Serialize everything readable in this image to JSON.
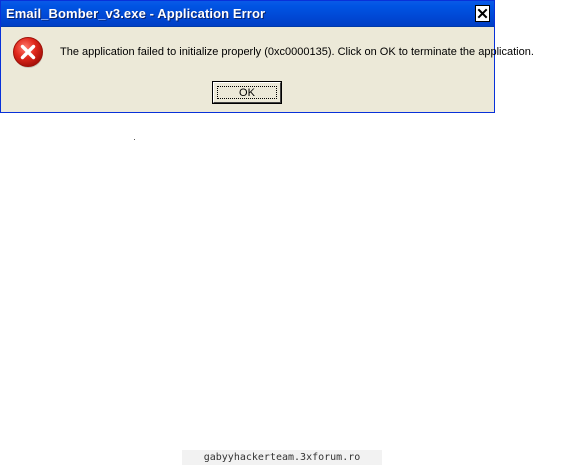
{
  "window": {
    "title": "Email_Bomber_v3.exe - Application Error",
    "close_icon": "close-icon"
  },
  "dialog": {
    "icon": "error-icon",
    "message": "The application failed to initialize properly (0xc0000135). Click on OK to terminate the application.",
    "ok_label": "OK"
  },
  "footer": {
    "watermark": "gabyyhackerteam.3xforum.ro"
  },
  "colors": {
    "titlebar": "#0054e3",
    "dialog_bg": "#ece9d8",
    "error_red": "#d4251a"
  }
}
